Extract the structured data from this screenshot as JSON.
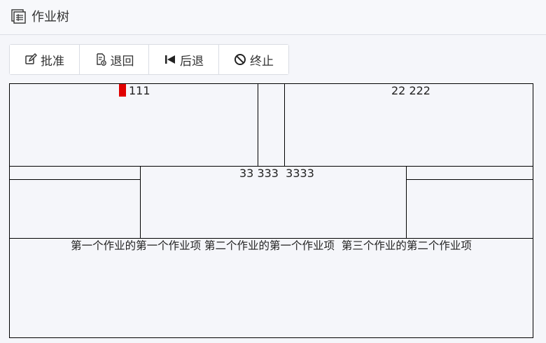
{
  "header": {
    "title": "作业树",
    "icon": "tree-grid-icon"
  },
  "toolbar": {
    "buttons": [
      {
        "label": "批准",
        "icon": "approve-edit-icon"
      },
      {
        "label": "退回",
        "icon": "return-document-icon"
      },
      {
        "label": "后退",
        "icon": "skip-back-icon"
      },
      {
        "label": "终止",
        "icon": "ban-icon"
      }
    ]
  },
  "tree": {
    "level1": {
      "left_label": "111",
      "right_label": "22 222"
    },
    "level2": {
      "center_label": "33 333  3333"
    },
    "level3": {
      "label": "第一个作业的第一个作业项 第二个作业的第一个作业项  第三个作业的第二个作业项"
    }
  },
  "colors": {
    "marker": "#e00000",
    "border": "#000000",
    "background": "#f5f6fa"
  }
}
